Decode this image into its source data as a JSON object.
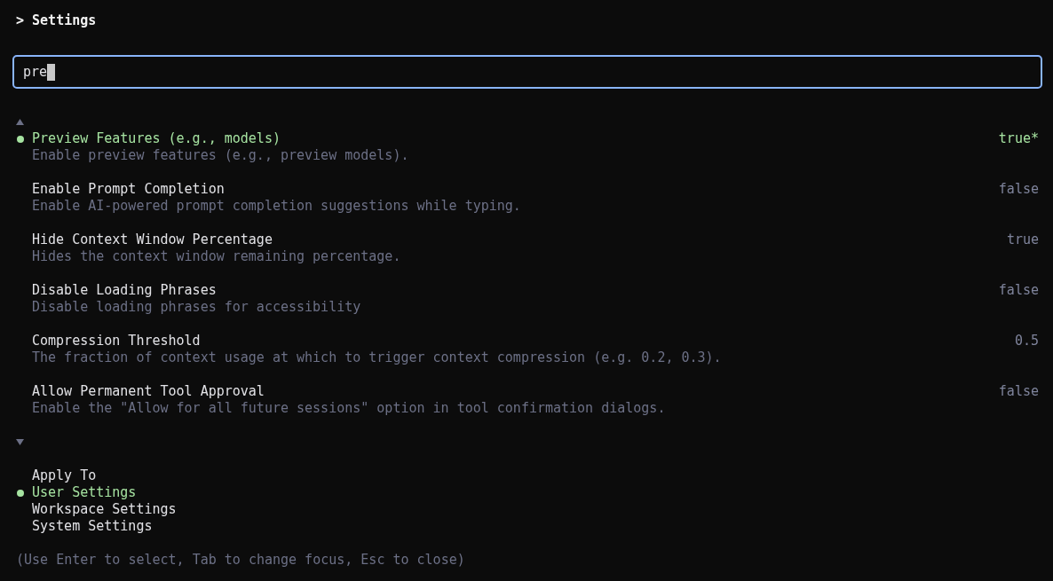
{
  "header": {
    "title": "> Settings"
  },
  "search": {
    "value": "pre",
    "focused": true
  },
  "settings": {
    "more_above": true,
    "items": [
      {
        "label": "Preview Features (e.g., models)",
        "description": "Enable preview features (e.g., preview models).",
        "value": "true*",
        "selected": true
      },
      {
        "label": "Enable Prompt Completion",
        "description": "Enable AI-powered prompt completion suggestions while typing.",
        "value": "false",
        "selected": false
      },
      {
        "label": "Hide Context Window Percentage",
        "description": "Hides the context window remaining percentage.",
        "value": "true",
        "selected": false
      },
      {
        "label": "Disable Loading Phrases",
        "description": "Disable loading phrases for accessibility",
        "value": "false",
        "selected": false
      },
      {
        "label": "Compression Threshold",
        "description": "The fraction of context usage at which to trigger context compression (e.g. 0.2, 0.3).",
        "value": "0.5",
        "selected": false
      },
      {
        "label": "Allow Permanent Tool Approval",
        "description": "Enable the \"Allow for all future sessions\" option in tool confirmation dialogs.",
        "value": "false",
        "selected": false
      }
    ],
    "more_below": true
  },
  "apply_to": {
    "title": "Apply To",
    "options": [
      {
        "label": "User Settings",
        "selected": true
      },
      {
        "label": "Workspace Settings",
        "selected": false
      },
      {
        "label": "System Settings",
        "selected": false
      }
    ]
  },
  "help_text": "(Use Enter to select, Tab to change focus, Esc to close)"
}
